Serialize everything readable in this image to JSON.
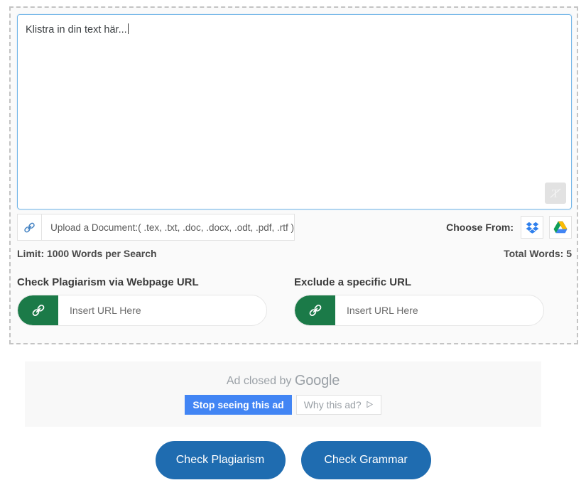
{
  "editor": {
    "text": "Klistra in din text här...",
    "grammar_icon": "grammarly-T-icon"
  },
  "upload": {
    "icon": "link-chain-icon",
    "label": "Upload a Document:( .tex, .txt, .doc, .docx, .odt, .pdf, .rtf )",
    "choose_from_label": "Choose From:",
    "sources": [
      {
        "name": "dropbox-icon",
        "label": "Dropbox"
      },
      {
        "name": "google-drive-icon",
        "label": "Google Drive"
      }
    ]
  },
  "counters": {
    "limit": "Limit: 1000 Words per Search",
    "total_words": "Total Words: 5"
  },
  "url_sections": [
    {
      "heading": "Check Plagiarism via Webpage URL",
      "icon": "link-chain-icon",
      "placeholder": "Insert URL Here",
      "value": ""
    },
    {
      "heading": "Exclude a specific URL",
      "icon": "link-chain-icon",
      "placeholder": "Insert URL Here",
      "value": ""
    }
  ],
  "ad": {
    "closed_prefix": "Ad closed by ",
    "brand": "Google",
    "stop_label": "Stop seeing this ad",
    "why_label": "Why this ad?",
    "why_icon": "triangle-play-icon"
  },
  "actions": {
    "plagiarism_label": "Check Plagiarism",
    "grammar_label": "Check Grammar"
  },
  "colors": {
    "accent_blue": "#1f6cb0",
    "ad_blue": "#4285f4",
    "url_green": "#1b7a48",
    "editor_border": "#73b6e8",
    "dashed_border": "#c4c4c4"
  }
}
